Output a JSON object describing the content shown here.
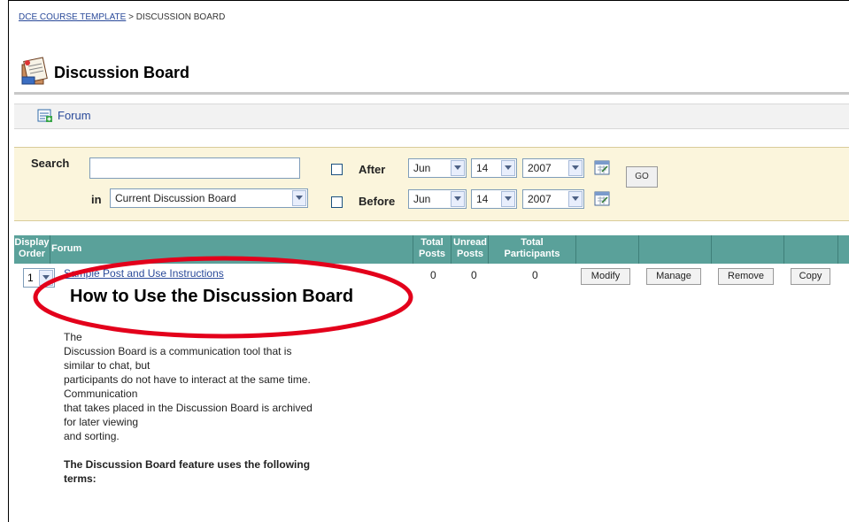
{
  "breadcrumb": {
    "course_link": "DCE COURSE TEMPLATE",
    "separator": ">",
    "current": "DISCUSSION BOARD"
  },
  "page": {
    "title": "Discussion Board",
    "icon": "discussion-board-icon"
  },
  "action_bar": {
    "forum_label": "Forum",
    "forum_icon": "add-forum-icon"
  },
  "search": {
    "label": "Search",
    "query": "",
    "in_label": "in",
    "scope": "Current Discussion Board",
    "after_label": "After",
    "after_month": "Jun",
    "after_day": "14",
    "after_year": "2007",
    "before_label": "Before",
    "before_month": "Jun",
    "before_day": "14",
    "before_year": "2007",
    "go_label": "GO"
  },
  "table": {
    "headers": {
      "display_order_1": "Display",
      "display_order_2": "Order",
      "forum": "Forum",
      "total_posts_1": "Total",
      "total_posts_2": "Posts",
      "unread_posts_1": "Unread",
      "unread_posts_2": "Posts",
      "total_participants_1": "Total",
      "total_participants_2": "Participants"
    },
    "row": {
      "order": "1",
      "forum_link": "Sample Post and Use Instructions",
      "forum_heading": "How to Use the Discussion Board",
      "total_posts": "0",
      "unread_posts": "0",
      "total_participants": "0",
      "buttons": {
        "modify": "Modify",
        "manage": "Manage",
        "remove": "Remove",
        "copy": "Copy"
      }
    },
    "description": {
      "line1": "The",
      "line2": "Discussion Board is a communication tool that is",
      "line3": "similar to chat, but",
      "line4": "participants do not have to interact at the same time.",
      "line5": "Communication",
      "line6": "that takes placed in the Discussion Board is archived",
      "line7": "for later viewing",
      "line8": "and sorting.",
      "terms_heading_1": "The Discussion Board feature uses the following",
      "terms_heading_2": "terms:"
    }
  },
  "colors": {
    "header_teal": "#5aa19a",
    "search_bg": "#fbf5dc",
    "link_blue": "#2a4a9a",
    "annotation_red": "#e3001b"
  }
}
